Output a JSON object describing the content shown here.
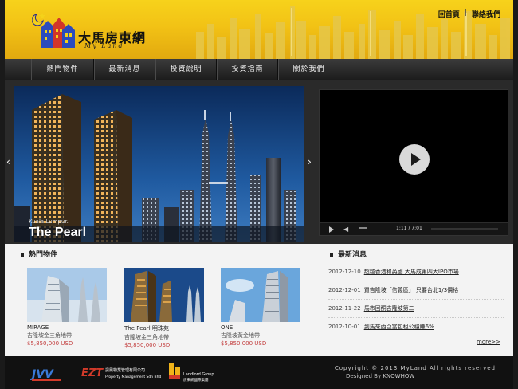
{
  "header": {
    "brand_name": "大馬房東網",
    "brand_sub": "My Land",
    "toplinks": [
      "回首頁",
      "聯絡我們"
    ],
    "toplink_sep": "|"
  },
  "nav": {
    "items": [
      "熱門物件",
      "最新消息",
      "投資說明",
      "投資指南",
      "關於我們"
    ]
  },
  "banner": {
    "caption_small": "Kuala Lumpur.",
    "caption_big": "The Pearl",
    "arrow_left": "‹",
    "arrow_right": "›"
  },
  "video": {
    "time": "1:11 / 7:01"
  },
  "hot": {
    "title": "熱門物件",
    "properties": [
      {
        "name": "MIRAGE",
        "location": "吉隆坡金三角地帶",
        "price": "$5,850,000 USD"
      },
      {
        "name": "The Pearl 明珠苑",
        "location": "吉隆坡金三角地帶",
        "price": "$5,850,000 USD"
      },
      {
        "name": "ONE",
        "location": "吉隆坡黃金地帶",
        "price": "$5,850,000 USD"
      }
    ]
  },
  "news": {
    "title": "最新消息",
    "items": [
      {
        "date": "2012-12-10",
        "title": "超越香港和英國 大馬成第四大IPO市場"
      },
      {
        "date": "2012-12-01",
        "title": "買吉隆坡「信義區」 只要台北1/3價格"
      },
      {
        "date": "2012-11-22",
        "title": "馬市回酮吉隆坡第二"
      },
      {
        "date": "2012-10-01",
        "title": "到馬來西亞當包租公穩賺6%"
      }
    ],
    "more": "more>>"
  },
  "footer": {
    "logos": [
      "JVV",
      "EZT 訊鳳物業管理有限公司 Property Management Sdn Bhd",
      "Landlord Group 房東網國際集團"
    ],
    "copyright": "Copyright © 2013  MyLand All rights reserved",
    "designed_by": "Designed By KNOWHOW"
  },
  "colors": {
    "header_yellow": "#f2c215",
    "nav_dark": "#1c1c1c",
    "price_red": "#c23b3b"
  }
}
